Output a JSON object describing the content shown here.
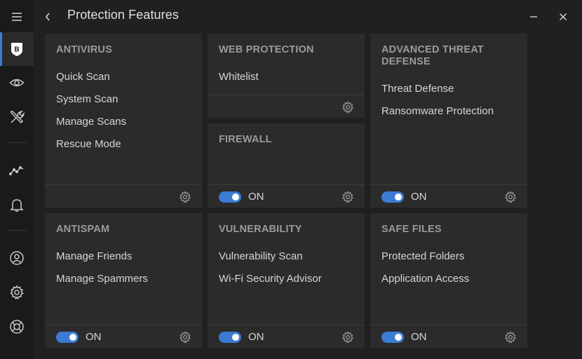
{
  "header": {
    "title": "Protection Features"
  },
  "sidebar": {
    "items": [
      {
        "icon": "hamburger-menu-icon"
      },
      {
        "icon": "bitdefender-logo-icon",
        "active": true,
        "logo_letter": "B"
      },
      {
        "icon": "eye-icon"
      },
      {
        "icon": "tools-icon"
      },
      {
        "icon": "activity-graph-icon"
      },
      {
        "icon": "bell-icon"
      },
      {
        "icon": "account-icon"
      },
      {
        "icon": "gear-icon"
      },
      {
        "icon": "lifebuoy-icon"
      }
    ]
  },
  "window_controls": {
    "minimize_icon": "minimize-icon",
    "close_icon": "close-icon"
  },
  "cards": {
    "antivirus": {
      "title": "ANTIVIRUS",
      "links": [
        "Quick Scan",
        "System Scan",
        "Manage Scans",
        "Rescue Mode"
      ]
    },
    "web_protection": {
      "title": "WEB PROTECTION",
      "links": [
        "Whitelist"
      ]
    },
    "firewall": {
      "title": "FIREWALL",
      "toggle_label": "ON"
    },
    "advanced_threat_defense": {
      "title": "ADVANCED THREAT DEFENSE",
      "links": [
        "Threat Defense",
        "Ransomware Protection"
      ],
      "toggle_label": "ON"
    },
    "antispam": {
      "title": "ANTISPAM",
      "links": [
        "Manage Friends",
        "Manage Spammers"
      ],
      "toggle_label": "ON"
    },
    "vulnerability": {
      "title": "VULNERABILITY",
      "links": [
        "Vulnerability Scan",
        "Wi-Fi Security Advisor"
      ],
      "toggle_label": "ON"
    },
    "safe_files": {
      "title": "SAFE FILES",
      "links": [
        "Protected Folders",
        "Application Access"
      ],
      "toggle_label": "ON"
    }
  },
  "colors": {
    "accent": "#3b7bd4",
    "background": "#202020",
    "card": "#2b2b2b",
    "sidebar": "#1a1a1a"
  }
}
